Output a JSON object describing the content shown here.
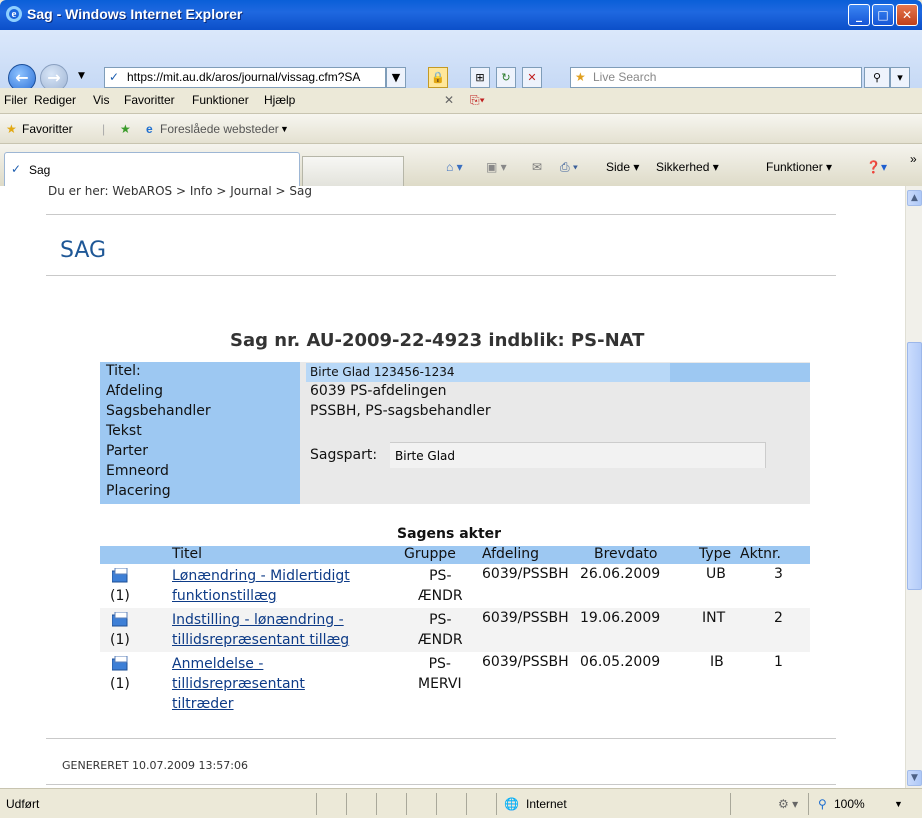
{
  "window": {
    "title": "Sag - Windows Internet Explorer"
  },
  "address": {
    "url": "https://mit.au.dk/aros/journal/vissag.cfm?SA",
    "search_placeholder": "Live Search"
  },
  "menu": [
    "Filer",
    "Rediger",
    "Vis",
    "Favoritter",
    "Funktioner",
    "Hjælp"
  ],
  "favorites": {
    "label": "Favoritter",
    "suggested": "Foreslåede websteder"
  },
  "tab": {
    "label": "Sag"
  },
  "command_bar": {
    "side": "Side",
    "sikkerhed": "Sikkerhed",
    "funktioner": "Funktioner"
  },
  "page": {
    "breadcrumb": "Du er her:  WebAROS > Info > Journal > Sag",
    "heading": "SAG",
    "case_title": "Sag nr. AU-2009-22-4923 indblik: PS-NAT",
    "info": {
      "labels": [
        "Titel:",
        "Afdeling",
        "Sagsbehandler",
        "Tekst",
        "Parter",
        "Emneord",
        "Placering"
      ],
      "titel": "Birte Glad 123456-1234",
      "afdeling": "6039 PS-afdelingen",
      "sagsbehandler": "PSSBH, PS-sagsbehandler",
      "sagspart_label": "Sagspart:",
      "sagspart": "Birte Glad"
    },
    "akter": {
      "caption": "Sagens akter",
      "headers": [
        "Titel",
        "Gruppe",
        "Afdeling",
        "Brevdato",
        "Type",
        "Aktnr."
      ],
      "rows": [
        {
          "count": "(1)",
          "titel_l1": "Lønændring - Midlertidigt",
          "titel_l2": "funktionstillæg",
          "titel_l3": "",
          "gruppe_l1": "PS-",
          "gruppe_l2": "ÆNDR",
          "afdeling": "6039/PSSBH",
          "brevdato": "26.06.2009",
          "type": "UB",
          "aktnr": "3"
        },
        {
          "count": "(1)",
          "titel_l1": "Indstilling - lønændring -",
          "titel_l2": "tillidsrepræsentant tillæg",
          "titel_l3": "",
          "gruppe_l1": "PS-",
          "gruppe_l2": "ÆNDR",
          "afdeling": "6039/PSSBH",
          "brevdato": "19.06.2009",
          "type": "INT",
          "aktnr": "2"
        },
        {
          "count": "(1)",
          "titel_l1": "Anmeldelse -",
          "titel_l2": "tillidsrepræsentant",
          "titel_l3": "tiltræder",
          "gruppe_l1": "PS-",
          "gruppe_l2": "MERVI",
          "afdeling": "6039/PSSBH",
          "brevdato": "06.05.2009",
          "type": "IB",
          "aktnr": "1"
        }
      ]
    },
    "generated": "GENERERET 10.07.2009 13:57:06"
  },
  "status": {
    "left": "Udført",
    "zone": "Internet",
    "zoom": "100%"
  },
  "colors": {
    "label_bg": "#9dc8f2",
    "link": "#0d3b87",
    "heading": "#1e5796"
  }
}
